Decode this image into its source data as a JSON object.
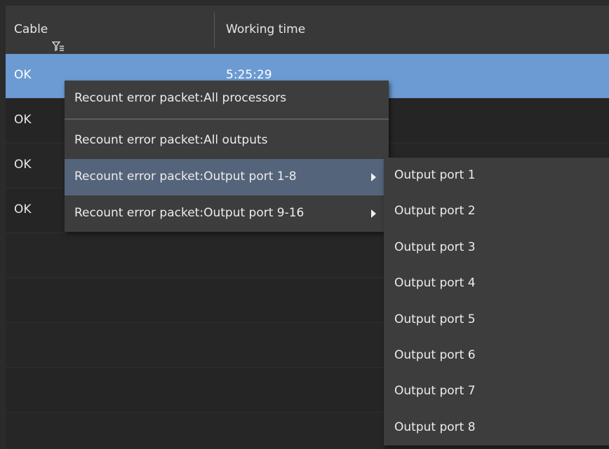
{
  "header": {
    "cable_label": "Cable",
    "working_time_label": "Working time"
  },
  "rows": [
    {
      "status": "OK",
      "time": "5:25:29",
      "selected": true
    },
    {
      "status": "OK",
      "time": ""
    },
    {
      "status": "OK",
      "time": ""
    },
    {
      "status": "OK",
      "time": ""
    },
    {
      "status": "",
      "time": ""
    },
    {
      "status": "",
      "time": ""
    },
    {
      "status": "",
      "time": ""
    },
    {
      "status": "",
      "time": ""
    },
    {
      "status": "",
      "time": ""
    }
  ],
  "context_menu": {
    "items": [
      "Recount error packet:All processors",
      "Recount error packet:All outputs",
      "Recount error packet:Output port 1-8",
      "Recount error packet:Output port 9-16"
    ],
    "highlighted_index": 2
  },
  "submenu": {
    "items": [
      "Output port 1",
      "Output port 2",
      "Output port 3",
      "Output port 4",
      "Output port 5",
      "Output port 6",
      "Output port 7",
      "Output port 8"
    ]
  },
  "colors": {
    "selected_row": "#6b9bd2",
    "menu_bg": "#3d3d3d",
    "menu_hover": "#54647a",
    "header_bg": "#383838"
  }
}
